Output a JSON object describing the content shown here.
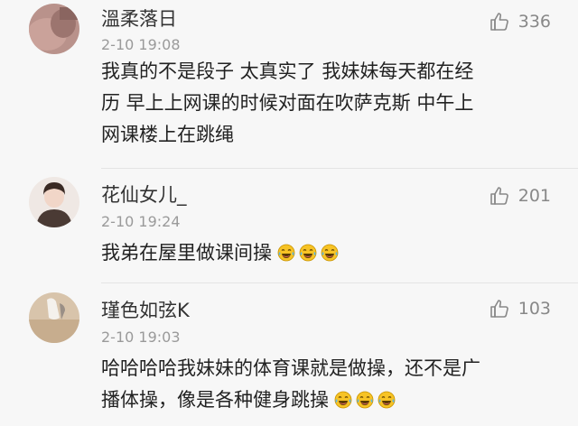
{
  "comments": [
    {
      "username": "溫柔落日",
      "time": "2-10 19:08",
      "likes": "336",
      "lines": [
        "我真的不是段子 太真实了 我妹妹每天都在经",
        "历 早上上网课的时候对面在吹萨克斯 中午上",
        "网课楼上在跳绳"
      ],
      "emoji_count": 0
    },
    {
      "username": "花仙女儿_",
      "time": "2-10 19:24",
      "likes": "201",
      "lines": [
        "我弟在屋里做课间操"
      ],
      "emoji_count": 3
    },
    {
      "username": "瑾色如弦K",
      "time": "2-10 19:03",
      "likes": "103",
      "lines": [
        "哈哈哈哈我妹妹的体育课就是做操，还不是广",
        "播体操，像是各种健身跳操"
      ],
      "emoji_count": 3
    }
  ],
  "icons": {
    "like": "thumbs-up-icon",
    "emoji": "laughing-tears-emoji-icon"
  },
  "colors": {
    "background": "#f7f7f7",
    "text": "#222222",
    "meta": "#9a9a9a",
    "emoji": "#f7c325"
  }
}
